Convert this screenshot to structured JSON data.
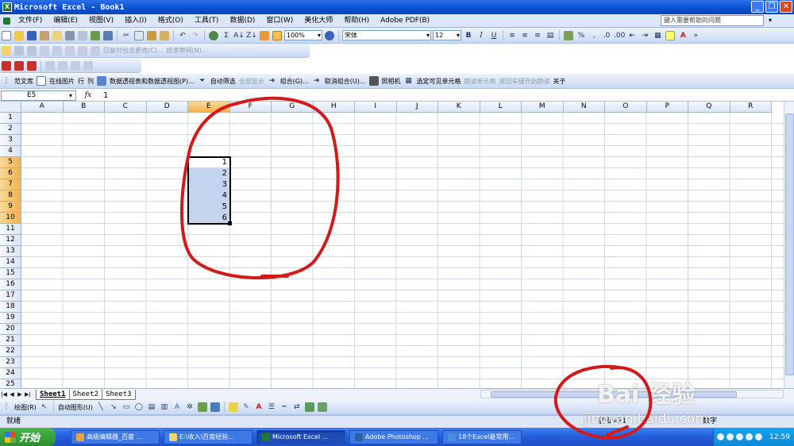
{
  "window": {
    "title": "Microsoft Excel - Book1",
    "app_icon": "X",
    "minimize": "_",
    "restore": "❐",
    "close": "✕"
  },
  "menu": {
    "items": [
      "文件(F)",
      "编辑(E)",
      "视图(V)",
      "插入(I)",
      "格式(O)",
      "工具(T)",
      "数据(D)",
      "窗口(W)",
      "美化大师",
      "帮助(H)",
      "Adobe PDF(B)"
    ],
    "help_placeholder": "键入需要帮助的问题"
  },
  "standard_toolbar": {
    "zoom": "100%",
    "font": "宋体",
    "font_size": "12",
    "bold": "B",
    "italic": "I",
    "underline": "U",
    "percent": "%",
    "comma": ","
  },
  "review_toolbar": {
    "reply_label": "回复时包含更改(C)...",
    "end_label": "结束审阅(N)..."
  },
  "extra_toolbar": {
    "items": [
      "范文库",
      "在线图片",
      "行",
      "列",
      "数据透视表和数据透视图(P)...",
      "自动筛选",
      "全部显示",
      "组合(G)...",
      "取消组合(U)...",
      "照相机",
      "选定可见单元格",
      "朗读单元格",
      "按回车键开始朗读",
      "关于"
    ]
  },
  "formula_bar": {
    "name_box": "E5",
    "fx": "fx",
    "value": "1"
  },
  "grid": {
    "columns": [
      "A",
      "B",
      "C",
      "D",
      "E",
      "F",
      "G",
      "H",
      "I",
      "J",
      "K",
      "L",
      "M",
      "N",
      "O",
      "P",
      "Q",
      "R"
    ],
    "rows": [
      "1",
      "2",
      "3",
      "4",
      "5",
      "6",
      "7",
      "8",
      "9",
      "10",
      "11",
      "12",
      "13",
      "14",
      "15",
      "16",
      "17",
      "18",
      "19",
      "20",
      "21",
      "22",
      "23",
      "24",
      "25"
    ],
    "selected_column": "E",
    "selected_rows": [
      "5",
      "6",
      "7",
      "8",
      "9",
      "10"
    ],
    "cell_values": [
      "1",
      "2",
      "3",
      "4",
      "5",
      "6"
    ]
  },
  "sheets": {
    "tabs": [
      "Sheet1",
      "Sheet2",
      "Sheet3"
    ],
    "active": "Sheet1"
  },
  "drawing_toolbar": {
    "draw_label": "绘图(R)",
    "autoshape_label": "自动图形(U)"
  },
  "status_bar": {
    "ready": "就绪",
    "sum": "求和=21",
    "mode": "数字"
  },
  "taskbar": {
    "start": "开始",
    "tasks": [
      {
        "label": "高级编辑器_百度 ...",
        "color": "#e8a53a"
      },
      {
        "label": "E:\\收入\\百度经验...",
        "color": "#f3d36a"
      },
      {
        "label": "Microsoft Excel ...",
        "color": "#1e7a2e"
      },
      {
        "label": "Adobe Photoshop ...",
        "color": "#2b5fa8"
      },
      {
        "label": "18个Excel最常用...",
        "color": "#4a8fe0"
      }
    ],
    "clock": "12:59"
  },
  "watermark": {
    "brand": "Bai 经验",
    "url": "jingyan.baidu.com"
  },
  "colors": {
    "selection": "#c4d3ee",
    "header_selected": "#f2b24e",
    "title_bar": "#0a4fd1",
    "annotation": "#d11a1a"
  }
}
